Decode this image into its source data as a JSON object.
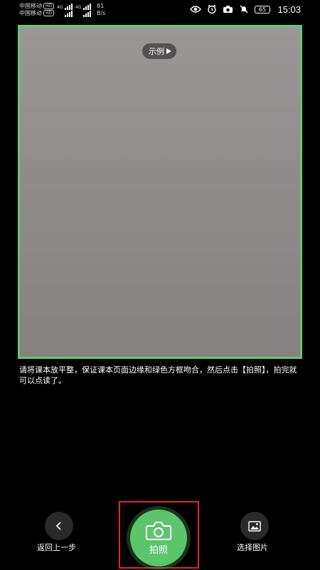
{
  "status_bar": {
    "carrier_1": "中国移动",
    "carrier_2": "中国移动",
    "hd_label": "HD",
    "network_1": "4G",
    "network_2": "4G",
    "speed_value": "81",
    "speed_unit": "B/s",
    "battery": "65",
    "time": "15:03",
    "icons": [
      "eye-icon",
      "alarm-icon",
      "camera-icon",
      "mute-icon",
      "battery-icon"
    ]
  },
  "camera": {
    "example_label": "示例",
    "frame_color": "#62c872"
  },
  "instruction": "请将课本放平整，保证课本页面边缘和绿色方框吻合，然后点击【拍照】，拍完就可以点读了。",
  "bottom_bar": {
    "back_label": "返回上一步",
    "shutter_label": "拍照",
    "gallery_label": "选择图片",
    "accent_color": "#5bc56c",
    "highlight_color": "#e0282a"
  }
}
